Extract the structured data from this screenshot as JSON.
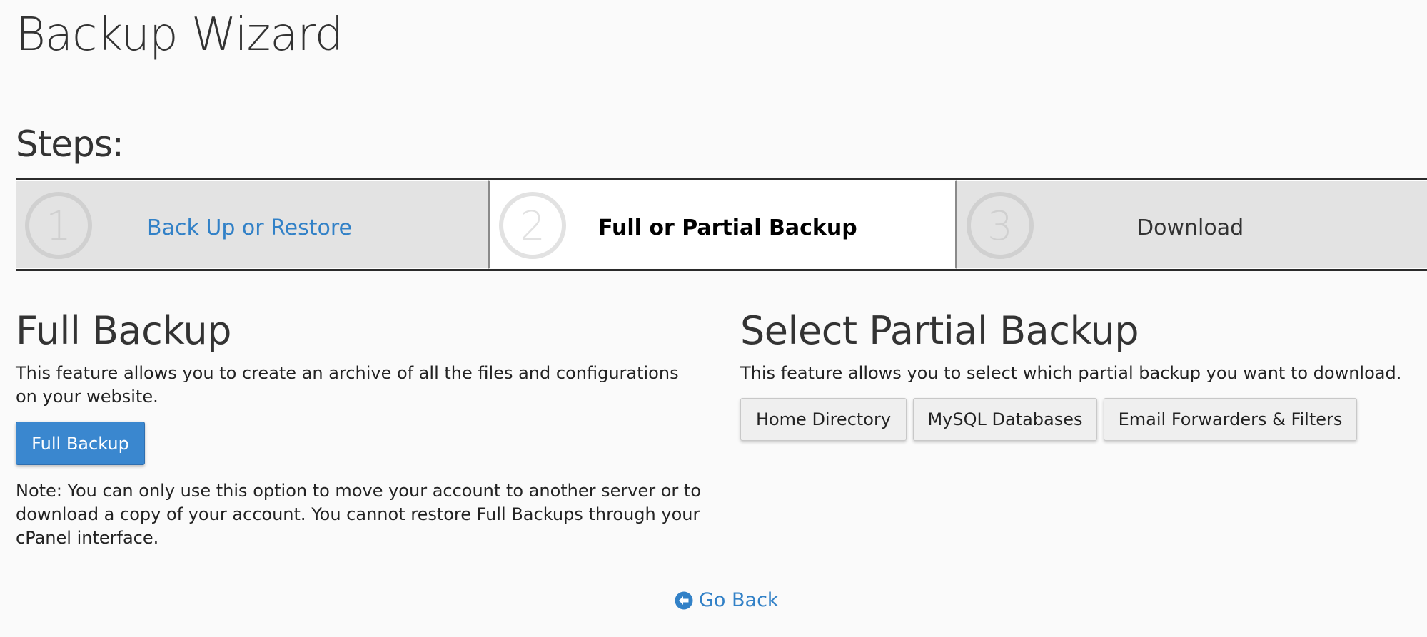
{
  "page": {
    "title": "Backup Wizard",
    "steps_heading": "Steps:"
  },
  "steps": [
    {
      "number": "1",
      "label": "Back Up or Restore",
      "state": "link",
      "icon": "circled-number-1-icon"
    },
    {
      "number": "2",
      "label": "Full or Partial Backup",
      "state": "current",
      "icon": "circled-number-2-icon"
    },
    {
      "number": "3",
      "label": "Download",
      "state": "upcoming",
      "icon": "circled-number-3-icon"
    }
  ],
  "full_backup": {
    "heading": "Full Backup",
    "description": "This feature allows you to create an archive of all the files and configurations on your website.",
    "button_label": "Full Backup",
    "note": "Note: You can only use this option to move your account to another server or to download a copy of your account. You cannot restore Full Backups through your cPanel interface."
  },
  "partial_backup": {
    "heading": "Select Partial Backup",
    "description": "This feature allows you to select which partial backup you want to download.",
    "buttons": [
      {
        "label": "Home Directory"
      },
      {
        "label": "MySQL Databases"
      },
      {
        "label": "Email Forwarders & Filters"
      }
    ]
  },
  "footer": {
    "go_back_label": "Go Back",
    "go_back_icon": "arrow-circle-left-icon"
  },
  "colors": {
    "link": "#3281c7",
    "primary_button": "#3a87cf",
    "step_inactive_bg": "#e3e3e3",
    "step_active_bg": "#ffffff"
  }
}
